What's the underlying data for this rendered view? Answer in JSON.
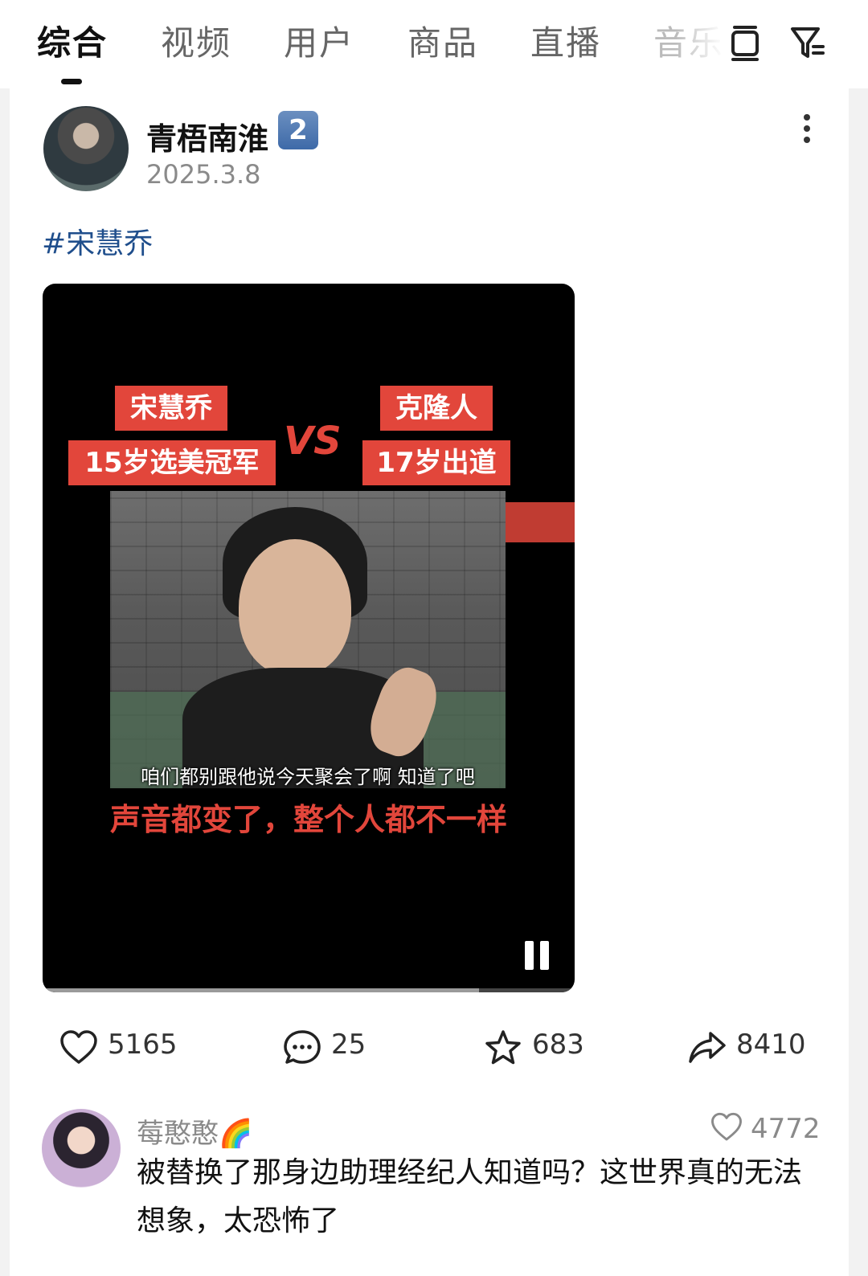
{
  "tabs": [
    {
      "label": "综合"
    },
    {
      "label": "视频"
    },
    {
      "label": "用户"
    },
    {
      "label": "商品"
    },
    {
      "label": "直播"
    },
    {
      "label": "音乐"
    }
  ],
  "post": {
    "author": "青梧南淮",
    "level_badge": "2",
    "date": "2025.3.8",
    "hashtag": "#宋慧乔",
    "video": {
      "left_title": "宋慧乔",
      "left_sub": "15岁选美冠军",
      "vs": "VS",
      "right_title": "克隆人",
      "right_sub": "17岁出道",
      "frame_subtitle": "咱们都别跟他说今天聚会了啊 知道了吧",
      "caption": "声音都变了，整个人都不一样",
      "progress": 0.82
    },
    "actions": {
      "likes": "5165",
      "comments": "25",
      "favorites": "683",
      "shares": "8410"
    }
  },
  "comment": {
    "user": "莓憨憨🌈",
    "likes": "4772",
    "text": "被替换了那身边助理经纪人知道吗？这世界真的无法想象，太恐怖了"
  },
  "colors": {
    "accent_red": "#e2463b",
    "hashtag_blue": "#1f4e8c"
  }
}
